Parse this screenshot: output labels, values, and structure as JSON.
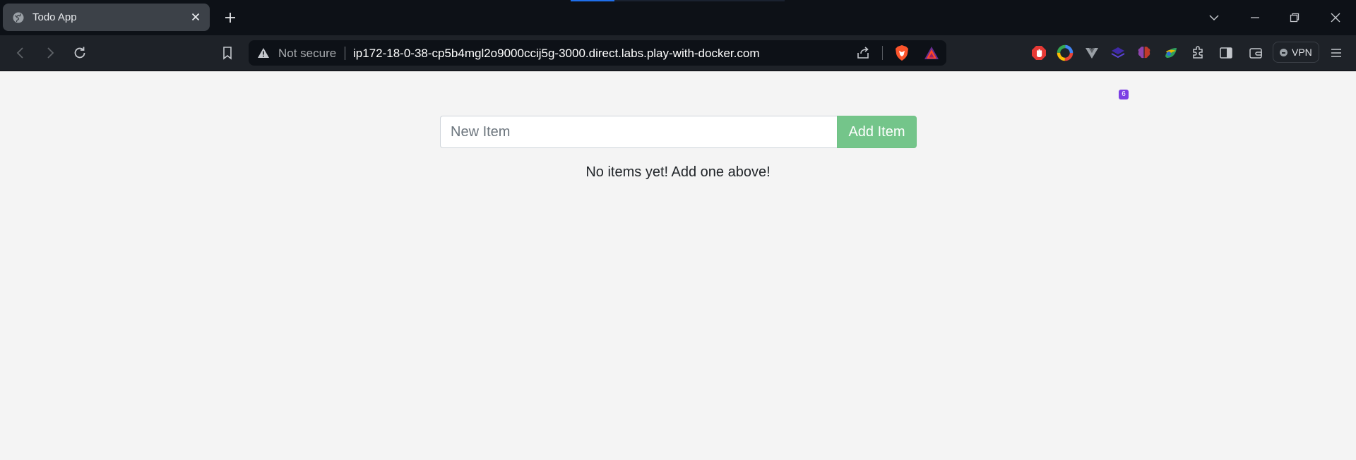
{
  "browser": {
    "tab": {
      "title": "Todo App"
    },
    "address_bar": {
      "security_label": "Not secure",
      "url": "ip172-18-0-38-cp5b4mgl2o9000ccij5g-3000.direct.labs.play-with-docker.com"
    },
    "extension_badge_count": "6",
    "vpn_label": "VPN",
    "icons": [
      "back-icon",
      "forward-icon",
      "reload-icon",
      "bookmark-icon",
      "warning-icon",
      "share-icon",
      "brave-shields-icon",
      "brave-rewards-icon",
      "extensions-icon",
      "sidebar-icon",
      "wallet-icon",
      "menu-icon"
    ]
  },
  "app": {
    "new_item": {
      "placeholder": "New Item",
      "value": ""
    },
    "add_button_label": "Add Item",
    "empty_message": "No items yet! Add one above!",
    "colors": {
      "accent": "#74c58a",
      "background": "#f4f4f4"
    }
  }
}
